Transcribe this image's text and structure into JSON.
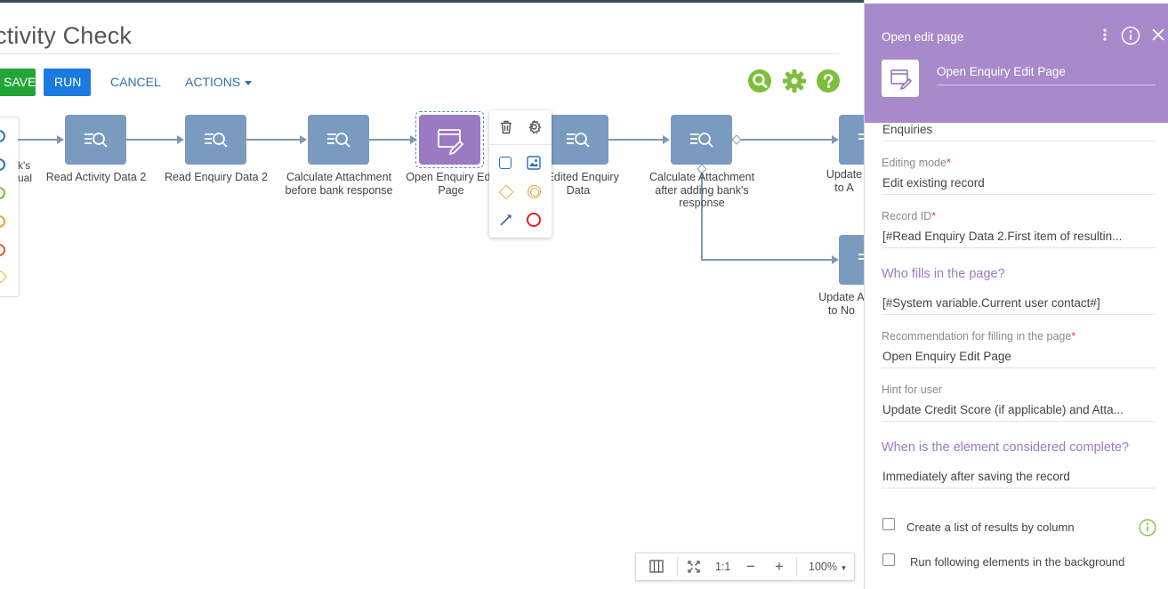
{
  "process": {
    "title": "ctivity Check",
    "buttons": {
      "save": "SAVE",
      "run": "RUN",
      "cancel": "CANCEL",
      "actions": "ACTIONS"
    }
  },
  "palette_labels": {
    "left_partial_1": "k's",
    "left_partial_2": "ual"
  },
  "nodes": [
    {
      "label_line1": "Read Activity Data 2",
      "label_line2": ""
    },
    {
      "label_line1": "Read Enquiry Data 2",
      "label_line2": ""
    },
    {
      "label_line1": "Calculate Attachment",
      "label_line2": "before bank response"
    },
    {
      "label_line1": "Open Enquiry Edit",
      "label_line2": "Page"
    },
    {
      "label_line1": "d Edited Enquiry",
      "label_line2": "Data"
    },
    {
      "label_line1": "Calculate Attachment",
      "label_line2": "after adding bank's",
      "label_line3": "response"
    },
    {
      "label_line1": "Update",
      "label_line2": "to A"
    },
    {
      "label_line1": "Update A",
      "label_line2": "to No"
    }
  ],
  "zoom": {
    "fit_label": "1:1",
    "minus": "−",
    "plus": "+",
    "level": "100%"
  },
  "panel": {
    "header_title": "Open edit page",
    "element_name": "Open Enquiry Edit Page",
    "object_value": "Enquiries",
    "editing_mode": {
      "label": "Editing mode",
      "value": "Edit existing record"
    },
    "record_id": {
      "label": "Record ID",
      "value": "[#Read Enquiry Data 2.First item of resultin..."
    },
    "who_fills": {
      "section": "Who fills in the page?",
      "value": "[#System variable.Current user contact#]"
    },
    "recommendation": {
      "label": "Recommendation for filling in the page",
      "value": "Open Enquiry Edit Page"
    },
    "hint": {
      "label": "Hint for user",
      "value": "Update Credit Score (if applicable) and Atta..."
    },
    "completion": {
      "section": "When is the element considered complete?",
      "value": "Immediately after saving the record"
    },
    "checkbox_results": "Create a list of results by column",
    "checkbox_background": "Run following elements in the background",
    "required_mark": "*"
  },
  "colors": {
    "accent_purple": "#a78ac9",
    "node_blue": "#7a9bbf",
    "save_green": "#22a535",
    "run_blue": "#1a7ae0"
  }
}
